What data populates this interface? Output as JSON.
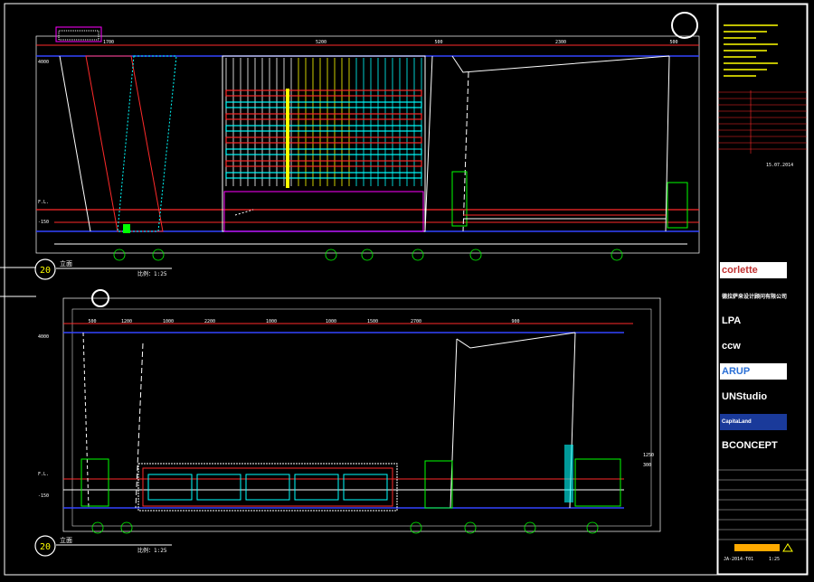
{
  "elevation_top": {
    "number": "20",
    "title": "立面",
    "scale": "比例：1:25",
    "dims": [
      "1700",
      "5200",
      "500",
      "2300",
      "500"
    ],
    "levels": [
      "4000",
      "F.L.",
      "-150"
    ]
  },
  "elevation_bottom": {
    "number": "20",
    "title": "立面",
    "scale": "比例：1:25",
    "dims": [
      "500",
      "1200",
      "1000",
      "2200",
      "1000",
      "1000",
      "1500",
      "2700",
      "900"
    ],
    "levels": [
      "4000",
      "F.L.",
      "-150"
    ],
    "right_dims": [
      "1250",
      "300"
    ]
  },
  "title_block": {
    "logos": [
      {
        "text": "corlette",
        "color": "#ffffff",
        "bg": "#ffffff"
      },
      {
        "text": "德拉萨来设计顾问有限公司",
        "color": "#ffffff",
        "bg": "#000000"
      },
      {
        "text": "LPA",
        "color": "#ffffff",
        "bg": "#000000"
      },
      {
        "text": "ccw",
        "color": "#ffffff",
        "bg": "#000000"
      },
      {
        "text": "ARUP",
        "color": "#2a6fd6",
        "bg": "#ffffff"
      },
      {
        "text": "UNStudio",
        "color": "#ffffff",
        "bg": "#000000"
      },
      {
        "text": "CapitaLand",
        "color": "#ffffff",
        "bg": "#1a3a9a"
      },
      {
        "text": "BCONCEPT",
        "color": "#ffffff",
        "bg": "#000000"
      }
    ],
    "date": "15.07.2014",
    "drawing_no": "JA-2014-T01",
    "scale": "1:25"
  },
  "colors": {
    "frame": "#ff2a2a",
    "outline": "#ffffff",
    "accent_yellow": "#ffff00",
    "accent_green": "#00ff00",
    "accent_cyan": "#00ffff",
    "accent_magenta": "#ff00ff",
    "accent_blue": "#3344ff"
  }
}
